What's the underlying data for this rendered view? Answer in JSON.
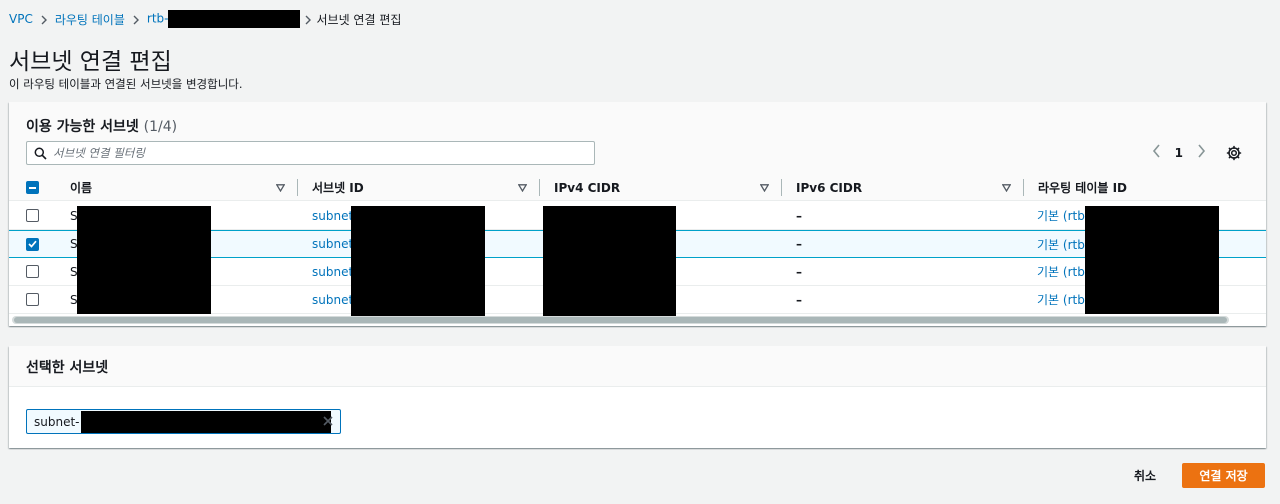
{
  "breadcrumb": {
    "vpc": "VPC",
    "route_tables": "라우팅 테이블",
    "rtb": "rtb-",
    "current": "서브넷 연결 편집"
  },
  "page": {
    "title": "서브넷 연결 편집",
    "description": "이 라우팅 테이블과 연결된 서브넷을 변경합니다."
  },
  "available": {
    "title": "이용 가능한 서브넷",
    "count": "(1/4)",
    "filter_placeholder": "서브넷 연결 필터링",
    "page_number": "1",
    "columns": [
      "이름",
      "서브넷 ID",
      "IPv4 CIDR",
      "IPv6 CIDR",
      "라우팅 테이블 ID"
    ],
    "rows": [
      {
        "name": "S",
        "subnet_id": "subnet-",
        "ipv6": "–",
        "route_table": "기본 (rtb-",
        "checked": false
      },
      {
        "name": "S",
        "subnet_id": "subnet-",
        "ipv6": "–",
        "route_table": "기본 (rtb-",
        "checked": true
      },
      {
        "name": "S",
        "subnet_id": "subnet-",
        "ipv6": "–",
        "route_table": "기본 (rtb-",
        "checked": false
      },
      {
        "name": "S",
        "subnet_id": "subnet-",
        "ipv6": "–",
        "route_table": "기본 (rtb-",
        "checked": false
      }
    ]
  },
  "selected": {
    "title": "선택한 서브넷",
    "token": "subnet-"
  },
  "footer": {
    "cancel": "취소",
    "save": "연결 저장"
  },
  "colors": {
    "link": "#0073bb",
    "primary": "#ec7211",
    "selected_row": "#f1faff"
  },
  "icons": [
    "chevron-right-icon",
    "search-icon",
    "chevron-left-icon",
    "gear-icon",
    "sort-caret-icon",
    "close-icon",
    "checkbox-icon"
  ]
}
